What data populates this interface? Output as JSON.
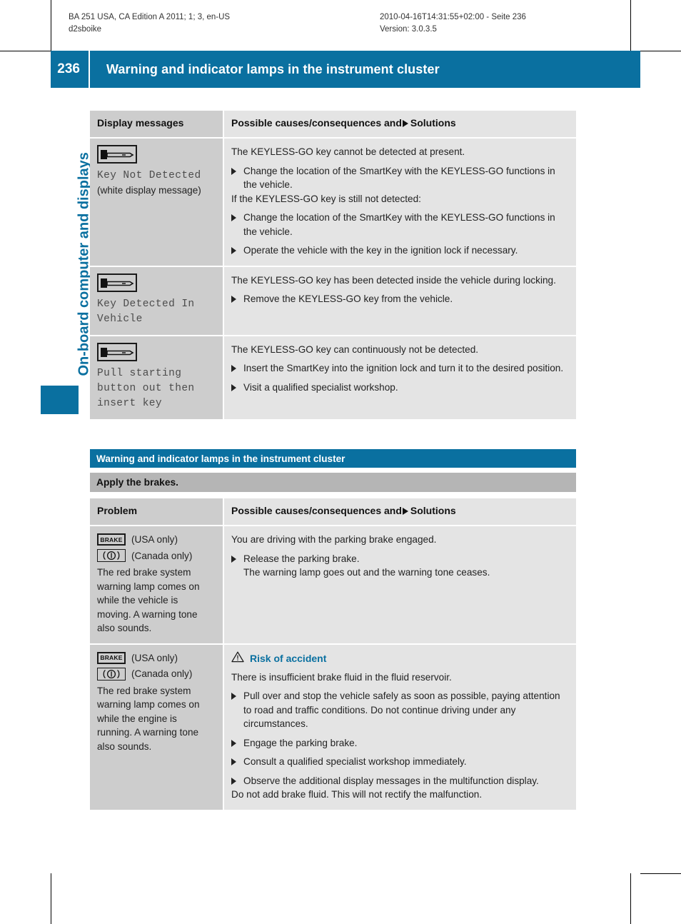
{
  "running_head": {
    "left_line1": "BA 251 USA, CA Edition A 2011; 1; 3, en-US",
    "left_line2": "d2sboike",
    "right_line1": "2010-04-16T14:31:55+02:00 - Seite 236",
    "right_line2": "Version: 3.0.3.5"
  },
  "header": {
    "page_number": "236",
    "title": "Warning and indicator lamps in the instrument cluster",
    "accent_color": "#0a70a0"
  },
  "chapter_tab": {
    "label": "On-board computer and displays",
    "color": "#0a70a0"
  },
  "table1": {
    "header": {
      "col1": "Display messages",
      "col2_before": "Possible causes/consequences and",
      "col2_after": "Solutions"
    },
    "rows": [
      {
        "icon": "keyless-go-key-icon",
        "display_message": "Key Not Detected",
        "note": "(white display message)",
        "right": [
          {
            "type": "para",
            "text": "The KEYLESS-GO key cannot be detected at present."
          },
          {
            "type": "bullet",
            "text": "Change the location of the SmartKey with the KEYLESS-GO functions in the vehicle."
          },
          {
            "type": "para",
            "text": "If the KEYLESS-GO key is still not detected:"
          },
          {
            "type": "bullet",
            "text": "Change the location of the SmartKey with the KEYLESS-GO functions in the vehicle."
          },
          {
            "type": "bullet",
            "text": "Operate the vehicle with the key in the ignition lock if necessary."
          }
        ]
      },
      {
        "icon": "keyless-go-key-icon",
        "display_message": "Key Detected In Vehicle",
        "note": "",
        "right": [
          {
            "type": "para",
            "text": "The KEYLESS-GO key has been detected inside the vehicle during locking."
          },
          {
            "type": "bullet",
            "text": "Remove the KEYLESS-GO key from the vehicle."
          }
        ]
      },
      {
        "icon": "keyless-go-key-icon",
        "display_message": "Pull starting button out then insert key",
        "note": "",
        "right": [
          {
            "type": "para",
            "text": "The KEYLESS-GO key can continuously not be detected."
          },
          {
            "type": "bullet",
            "text": "Insert the SmartKey into the ignition lock and turn it to the desired position."
          },
          {
            "type": "bullet",
            "text": "Visit a qualified specialist workshop."
          }
        ]
      }
    ]
  },
  "section2": {
    "title": "Warning and indicator lamps in the instrument cluster",
    "subtitle": "Apply the brakes.",
    "header": {
      "col1": "Problem",
      "col2_before": "Possible causes/consequences and",
      "col2_after": "Solutions"
    },
    "rows": [
      {
        "usa_icon_label": "BRAKE",
        "usa_note": "(USA only)",
        "canada_note": "(Canada only)",
        "description": "The red brake system warning lamp comes on while the vehicle is moving. A warning tone also sounds.",
        "warning": null,
        "right": [
          {
            "type": "para",
            "text": "You are driving with the parking brake engaged."
          },
          {
            "type": "bullet",
            "text": "Release the parking brake."
          },
          {
            "type": "bullet-cont",
            "text": "The warning lamp goes out and the warning tone ceases."
          }
        ]
      },
      {
        "usa_icon_label": "BRAKE",
        "usa_note": "(USA only)",
        "canada_note": "(Canada only)",
        "description": "The red brake system warning lamp comes on while the engine is running. A warning tone also sounds.",
        "warning": {
          "icon": "warning-triangle-icon",
          "title": "Risk of accident",
          "color": "#0a70a0"
        },
        "right": [
          {
            "type": "para",
            "text": "There is insufficient brake fluid in the fluid reservoir."
          },
          {
            "type": "bullet",
            "text": "Pull over and stop the vehicle safely as soon as possible, paying attention to road and traffic conditions. Do not continue driving under any circumstances."
          },
          {
            "type": "bullet",
            "text": "Engage the parking brake."
          },
          {
            "type": "bullet",
            "text": "Consult a qualified specialist workshop immediately."
          },
          {
            "type": "bullet",
            "text": "Observe the additional display messages in the multifunction display."
          },
          {
            "type": "para",
            "text": "Do not add brake fluid. This will not rectify the malfunction."
          }
        ]
      }
    ]
  }
}
